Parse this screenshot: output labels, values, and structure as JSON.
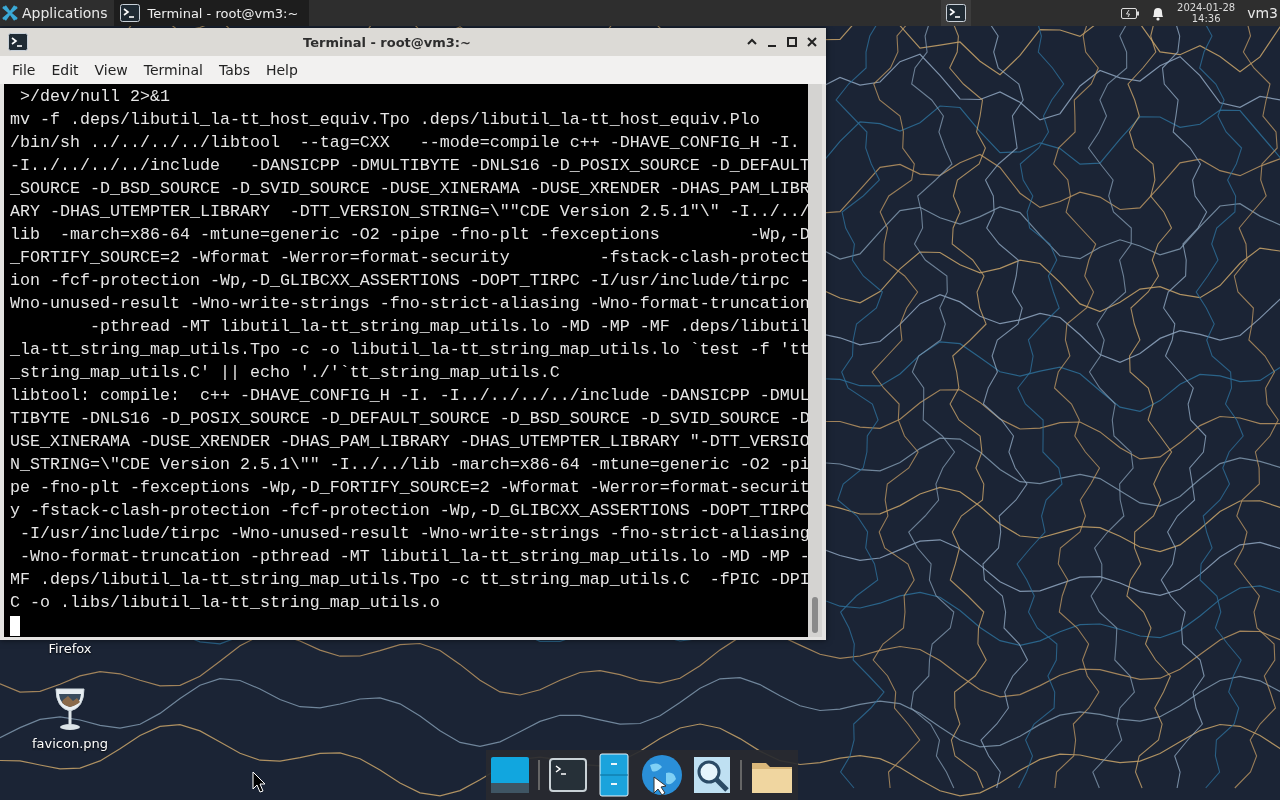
{
  "top_panel": {
    "applications_label": "Applications",
    "tasks": [
      {
        "label": "Terminal - root@vm3:~",
        "selected": true
      }
    ],
    "clock": {
      "date": "2024-01-28",
      "time": "14:36"
    },
    "user": "vm3"
  },
  "window": {
    "title": "Terminal - root@vm3:~",
    "menu": [
      "File",
      "Edit",
      "View",
      "Terminal",
      "Tabs",
      "Help"
    ],
    "terminal_lines": [
      " >/dev/null 2>&1",
      "mv -f .deps/libutil_la-tt_host_equiv.Tpo .deps/libutil_la-tt_host_equiv.Plo",
      "/bin/sh ../../../../libtool  --tag=CXX   --mode=compile c++ -DHAVE_CONFIG_H -I.",
      "-I../../../../include   -DANSICPP -DMULTIBYTE -DNLS16 -D_POSIX_SOURCE -D_DEFAULT",
      "_SOURCE -D_BSD_SOURCE -D_SVID_SOURCE -DUSE_XINERAMA -DUSE_XRENDER -DHAS_PAM_LIBR",
      "ARY -DHAS_UTEMPTER_LIBRARY  -DTT_VERSION_STRING=\\\"\"CDE Version 2.5.1\"\\\" -I../../",
      "lib  -march=x86-64 -mtune=generic -O2 -pipe -fno-plt -fexceptions         -Wp,-D",
      "_FORTIFY_SOURCE=2 -Wformat -Werror=format-security         -fstack-clash-protect",
      "ion -fcf-protection -Wp,-D_GLIBCXX_ASSERTIONS -DOPT_TIRPC -I/usr/include/tirpc -",
      "Wno-unused-result -Wno-write-strings -fno-strict-aliasing -Wno-format-truncation",
      "        -pthread -MT libutil_la-tt_string_map_utils.lo -MD -MP -MF .deps/libutil",
      "_la-tt_string_map_utils.Tpo -c -o libutil_la-tt_string_map_utils.lo `test -f 'tt",
      "_string_map_utils.C' || echo './'`tt_string_map_utils.C",
      "libtool: compile:  c++ -DHAVE_CONFIG_H -I. -I../../../../include -DANSICPP -DMUL",
      "TIBYTE -DNLS16 -D_POSIX_SOURCE -D_DEFAULT_SOURCE -D_BSD_SOURCE -D_SVID_SOURCE -D",
      "USE_XINERAMA -DUSE_XRENDER -DHAS_PAM_LIBRARY -DHAS_UTEMPTER_LIBRARY \"-DTT_VERSIO",
      "N_STRING=\\\"CDE Version 2.5.1\\\"\" -I../../lib -march=x86-64 -mtune=generic -O2 -pi",
      "pe -fno-plt -fexceptions -Wp,-D_FORTIFY_SOURCE=2 -Wformat -Werror=format-securit",
      "y -fstack-clash-protection -fcf-protection -Wp,-D_GLIBCXX_ASSERTIONS -DOPT_TIRPC",
      " -I/usr/include/tirpc -Wno-unused-result -Wno-write-strings -fno-strict-aliasing",
      " -Wno-format-truncation -pthread -MT libutil_la-tt_string_map_utils.lo -MD -MP -",
      "MF .deps/libutil_la-tt_string_map_utils.Tpo -c tt_string_map_utils.C  -fPIC -DPI",
      "C -o .libs/libutil_la-tt_string_map_utils.o"
    ]
  },
  "desktop_icons": [
    {
      "label": "Firefox"
    },
    {
      "label": "favicon.png"
    }
  ]
}
